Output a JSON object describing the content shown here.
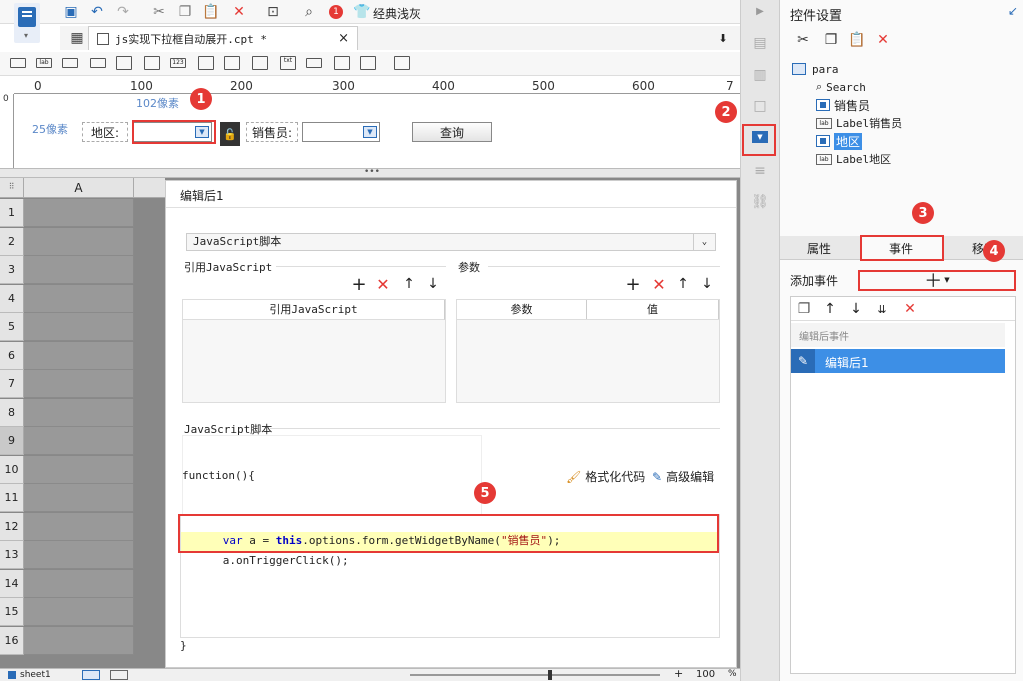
{
  "menubar": {
    "badge_count": "1",
    "theme_label": "经典浅灰"
  },
  "file_tab": {
    "title": "js实现下拉框自动展开.cpt *",
    "close": "×"
  },
  "ruler": {
    "ticks": [
      "0",
      "100",
      "200",
      "300",
      "400",
      "500",
      "600",
      "7"
    ],
    "vtick": "0"
  },
  "form": {
    "width_hint": "102像素",
    "height_hint": "25像素",
    "area_label": "地区:",
    "sales_label": "销售员:",
    "query_button": "查询"
  },
  "sheet": {
    "column_header": "A",
    "rows": [
      "1",
      "2",
      "3",
      "4",
      "5",
      "6",
      "7",
      "8",
      "9",
      "10",
      "11",
      "12",
      "13",
      "14",
      "15",
      "16"
    ],
    "tab_name": "sheet1",
    "zoom": "100",
    "zoom_unit": "%"
  },
  "dialog": {
    "title": "编辑后1",
    "type_select": "JavaScript脚本",
    "ref_js_section": "引用JavaScript",
    "params_section": "参数",
    "ref_js_col": "引用JavaScript",
    "param_col": "参数",
    "value_col": "值",
    "script_section": "JavaScript脚本",
    "func_open": "function(){",
    "format_code": "格式化代码",
    "advanced_edit": "高级编辑",
    "code_line1_kw1": "var",
    "code_line1_a": " a = ",
    "code_line1_kw2": "this",
    "code_line1_rest": ".options.form.getWidgetByName(",
    "code_line1_str": "\"销售员\"",
    "code_line1_end": ");",
    "code_line2": "a.onTriggerClick();",
    "func_close": "}"
  },
  "right_panel": {
    "title": "控件设置",
    "tree": {
      "root": "para",
      "items": [
        "Search",
        "销售员",
        "Label销售员",
        "地区",
        "Label地区"
      ]
    },
    "tabs": [
      "属性",
      "事件",
      "移动"
    ],
    "add_event_label": "添加事件",
    "event_group": "编辑后事件",
    "event_item": "编辑后1"
  },
  "badges": [
    "1",
    "2",
    "3",
    "4",
    "5"
  ]
}
